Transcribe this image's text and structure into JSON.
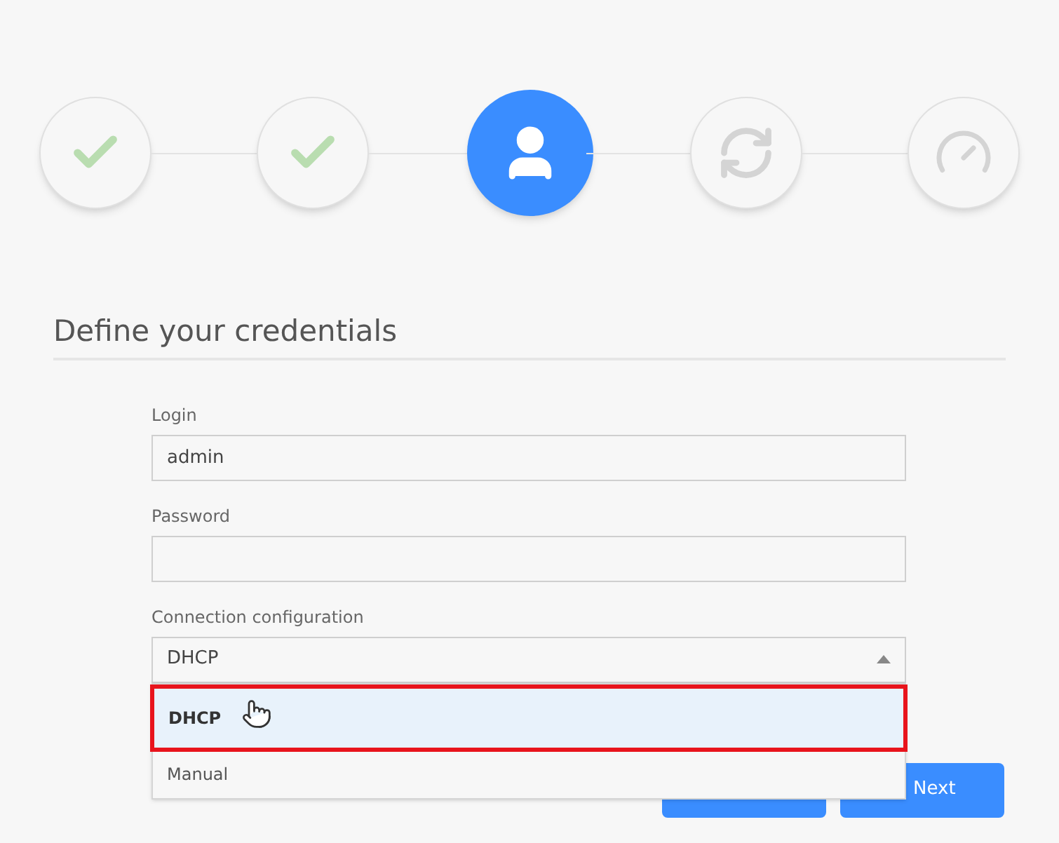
{
  "steps": [
    {
      "kind": "done",
      "selected": false
    },
    {
      "kind": "done",
      "selected": false
    },
    {
      "kind": "user",
      "selected": true
    },
    {
      "kind": "sync",
      "selected": false
    },
    {
      "kind": "gauge",
      "selected": false
    }
  ],
  "heading": "Define your credentials",
  "fields": [
    {
      "label": "Login",
      "value": "admin"
    },
    {
      "label": "Password"
    }
  ],
  "select": {
    "label": "Connection configuration",
    "value": "DHCP",
    "expanded": true,
    "options": [
      {
        "label": "DHCP",
        "selected": true,
        "highlighted": true
      },
      {
        "label": "Manual",
        "selected": false,
        "highlighted": false
      }
    ]
  },
  "buttons": [
    {
      "label": "Next"
    }
  ]
}
